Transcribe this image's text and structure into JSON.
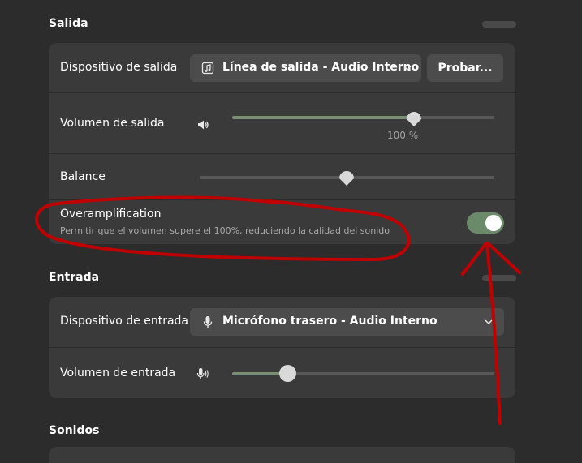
{
  "output": {
    "title": "Salida",
    "device_label": "Dispositivo de salida",
    "device_value": "Línea de salida - Audio Interno",
    "test_button": "Probar...",
    "volume_label": "Volumen de salida",
    "volume_percent": "100 %",
    "volume_level": 0.62,
    "balance_label": "Balance",
    "balance_level": 0.5,
    "overamp_label": "Overamplification",
    "overamp_desc": "Permitir que el volumen supere el 100%, reduciendo la calidad del sonido",
    "overamp_enabled": true
  },
  "input": {
    "title": "Entrada",
    "device_label": "Dispositivo de entrada",
    "device_value": "Micrófono trasero - Audio Interno",
    "volume_label": "Volumen de entrada",
    "volume_level": 0.21
  },
  "sounds": {
    "title": "Sonidos"
  },
  "colors": {
    "background": "#2c2c2c",
    "card": "#3a3a3a",
    "accent": "#6a8a6a",
    "annotation": "#c00000"
  },
  "icons": {
    "output_device": "music-note-icon",
    "output_volume": "speaker-icon",
    "input_device": "microphone-icon",
    "input_volume": "microphone-level-icon",
    "dropdown": "chevron-down-icon"
  }
}
